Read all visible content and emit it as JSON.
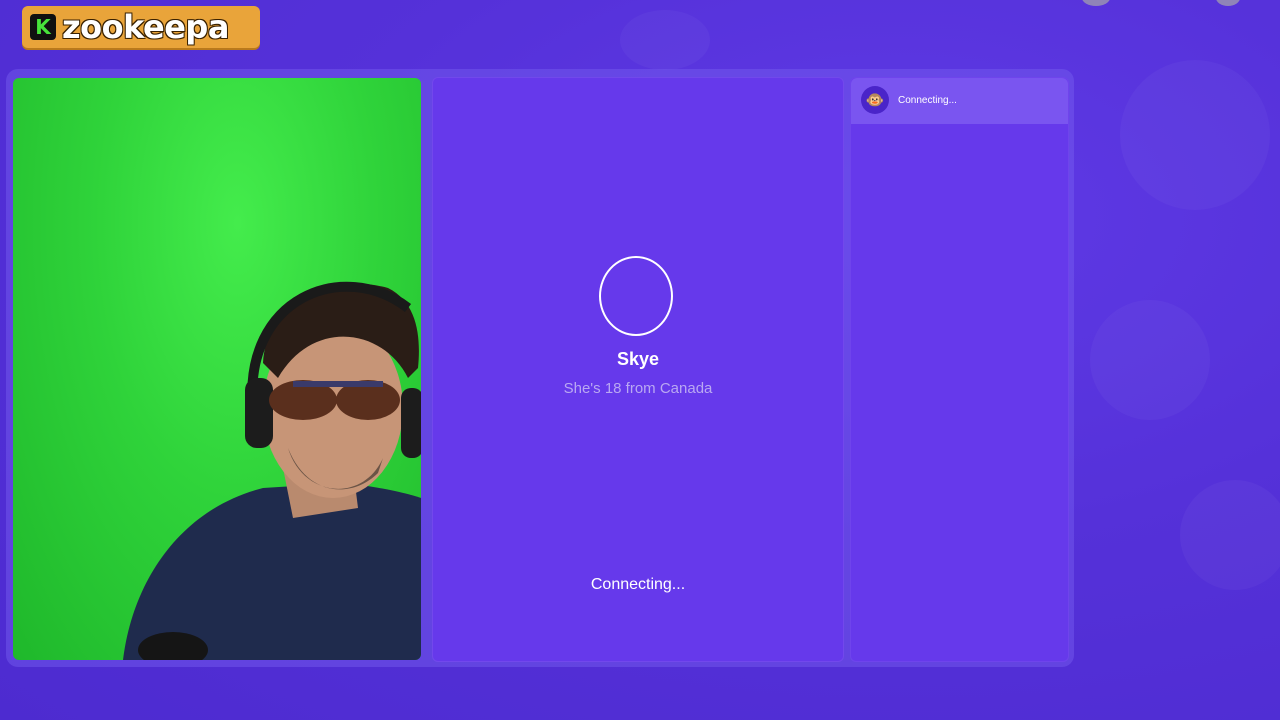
{
  "logo": {
    "k_letter": "K",
    "text": "zookeepa"
  },
  "remote": {
    "name": "Skye",
    "subtitle": "She's 18 from Canada",
    "status": "Connecting..."
  },
  "chat": {
    "avatar_glyph": "🐵",
    "status": "Connecting..."
  },
  "colors": {
    "background": "#5531d9",
    "panel": "#6639eb",
    "logo_bg": "#e9a43a",
    "self_video_bg": "#2fd33a"
  }
}
